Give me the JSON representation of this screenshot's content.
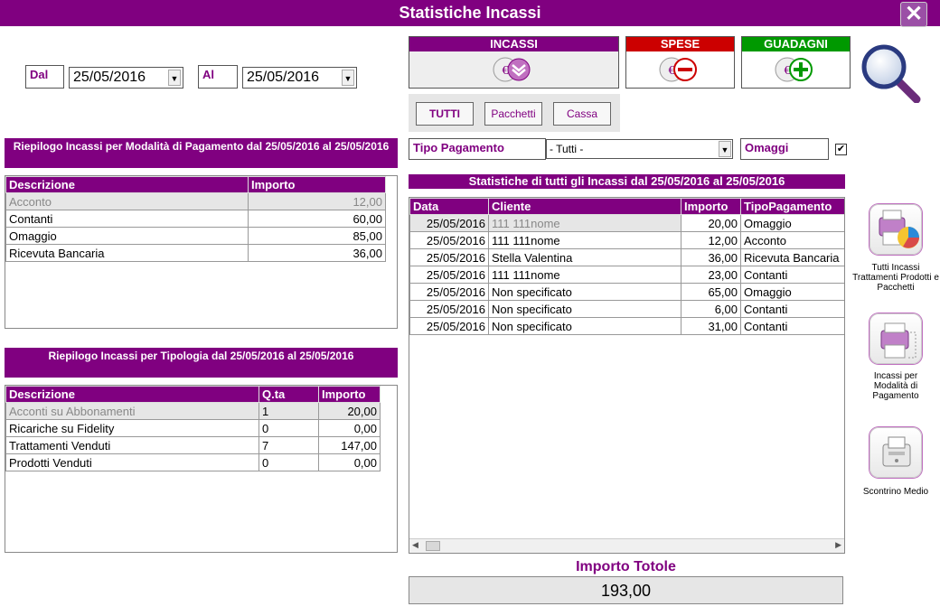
{
  "window": {
    "title": "Statistiche Incassi"
  },
  "dates": {
    "from_label": "Dal",
    "from_value": "25/05/2016",
    "to_label": "Al",
    "to_value": "25/05/2016"
  },
  "mode_buttons": {
    "incassi": {
      "label": "INCASSI",
      "color": "#800080"
    },
    "spese": {
      "label": "SPESE",
      "color": "#cc0000"
    },
    "guadagni": {
      "label": "GUADAGNI",
      "color": "#009900"
    }
  },
  "filter": {
    "tutti": "TUTTI",
    "pacchetti": "Pacchetti",
    "cassa": "Cassa"
  },
  "tipo_pagamento": {
    "label": "Tipo Pagamento",
    "value": "- Tutti -"
  },
  "omaggi": {
    "label": "Omaggi",
    "checked": true
  },
  "riepilogo_modalita": {
    "title": "Riepilogo Incassi per Modalità di Pagamento dal 25/05/2016 al 25/05/2016",
    "headers": [
      "Descrizione",
      "Importo"
    ],
    "rows": [
      [
        "Acconto",
        "12,00"
      ],
      [
        "Contanti",
        "60,00"
      ],
      [
        "Omaggio",
        "85,00"
      ],
      [
        "Ricevuta Bancaria",
        "36,00"
      ]
    ]
  },
  "riepilogo_tipologia": {
    "title": "Riepilogo Incassi per Tipologia dal 25/05/2016 al 25/05/2016",
    "headers": [
      "Descrizione",
      "Q.ta",
      "Importo"
    ],
    "rows": [
      [
        "Acconti su Abbonamenti",
        "1",
        "20,00"
      ],
      [
        "Ricariche su Fidelity",
        "0",
        "0,00"
      ],
      [
        "Trattamenti Venduti",
        "7",
        "147,00"
      ],
      [
        "Prodotti Venduti",
        "0",
        "0,00"
      ]
    ]
  },
  "statistiche": {
    "title": "Statistiche di tutti gli Incassi dal 25/05/2016 al 25/05/2016",
    "headers": [
      "Data",
      "Cliente",
      "Importo",
      "TipoPagamento"
    ],
    "rows": [
      [
        "25/05/2016",
        "111 111nome",
        "20,00",
        "Omaggio"
      ],
      [
        "25/05/2016",
        "111 111nome",
        "12,00",
        "Acconto"
      ],
      [
        "25/05/2016",
        "Stella Valentina",
        "36,00",
        "Ricevuta Bancaria"
      ],
      [
        "25/05/2016",
        "111 111nome",
        "23,00",
        "Contanti"
      ],
      [
        "25/05/2016",
        "Non specificato",
        "65,00",
        "Omaggio"
      ],
      [
        "25/05/2016",
        "Non specificato",
        "6,00",
        "Contanti"
      ],
      [
        "25/05/2016",
        "Non specificato",
        "31,00",
        "Contanti"
      ]
    ]
  },
  "side_buttons": {
    "tutti": "Tutti Incassi Trattamenti Prodotti e Pacchetti",
    "modalita": "Incassi per Modalità di Pagamento",
    "scontrino": "Scontrino Medio"
  },
  "totale": {
    "label": "Importo Totole",
    "value": "193,00"
  }
}
